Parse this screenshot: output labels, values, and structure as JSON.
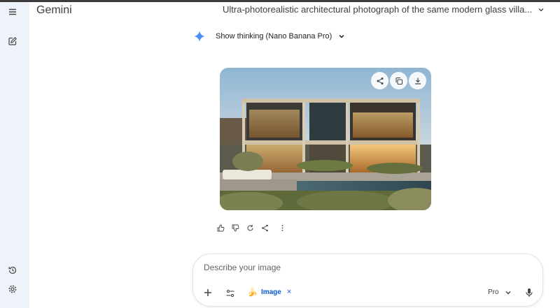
{
  "app": {
    "brand": "Gemini",
    "conversation_title": "Ultra-photorealistic architectural photograph of the same modern glass villa..."
  },
  "sidebar": {
    "menu_icon": "menu-icon",
    "new_chat_icon": "edit-icon",
    "history_icon": "history-icon",
    "settings_icon": "gear-icon"
  },
  "response": {
    "thinking_label": "Show thinking (Nano Banana Pro)",
    "image": {
      "subject": "modern glass villa",
      "actions": [
        "share-icon",
        "copy-icon",
        "download-icon"
      ]
    },
    "feedback_icons": [
      "thumbs-up-icon",
      "thumbs-down-icon",
      "regenerate-icon",
      "share-icon",
      "more-vert-icon"
    ]
  },
  "composer": {
    "placeholder": "Describe your image",
    "value": "",
    "tool_chip": {
      "emoji": "🍌",
      "label": "Image",
      "close": "×"
    },
    "model_label": "Pro"
  },
  "colors": {
    "sidebar_bg": "#eef2f9",
    "accent_blue": "#0b57d0",
    "sparkle_blue": "#4c8df6",
    "text_dark": "#1f1f1f"
  }
}
